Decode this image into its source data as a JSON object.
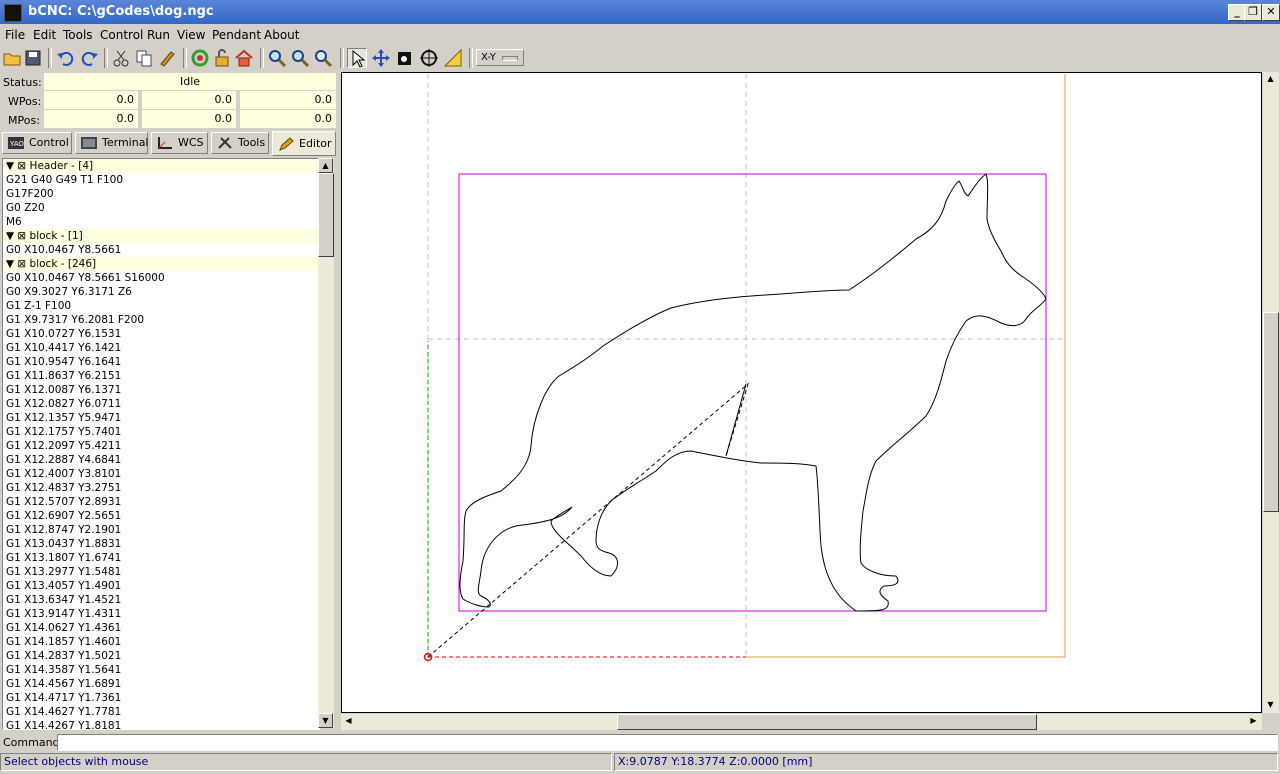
{
  "window": {
    "title": "bCNC: C:\\gCodes\\dog.ngc",
    "minimize": "_",
    "maximize": "❐",
    "close": "✕"
  },
  "menu": [
    "File",
    "Edit",
    "Tools",
    "Control",
    "Run",
    "View",
    "Pendant",
    "About"
  ],
  "toolbar": {
    "icons": [
      "open-icon",
      "save-icon",
      "undo-icon",
      "redo-icon",
      "cut-icon",
      "copy-icon",
      "paste-icon",
      "reload-icon",
      "unlock-icon",
      "home-icon",
      "zoom-in-icon",
      "zoom-out-icon",
      "zoom-fit-icon",
      "select-tool-icon",
      "pan-tool-icon",
      "camera-icon",
      "gantry-icon",
      "ruler-icon"
    ],
    "plane": "X-Y"
  },
  "status": {
    "label": "Status:",
    "value": "Idle",
    "wpos_label": "WPos:",
    "wpos": [
      "0.0",
      "0.0",
      "0.0"
    ],
    "mpos_label": "MPos:",
    "mpos": [
      "0.0",
      "0.0",
      "0.0"
    ]
  },
  "tabs": [
    "Control",
    "Terminal",
    "WCS",
    "Tools",
    "Editor"
  ],
  "selected_tab": "Editor",
  "editor_lines": [
    {
      "t": "▼ ⊠ Header - [4]",
      "block": true
    },
    {
      "t": "G21 G40 G49 T1 F100"
    },
    {
      "t": "G17F200"
    },
    {
      "t": "G0 Z20"
    },
    {
      "t": "M6"
    },
    {
      "t": "▼ ⊠ block - [1]",
      "block": true
    },
    {
      "t": "G0 X10.0467 Y8.5661"
    },
    {
      "t": "▼ ⊠ block - [246]",
      "block": true
    },
    {
      "t": "G0 X10.0467 Y8.5661 S16000"
    },
    {
      "t": "G0 X9.3027 Y6.3171 Z6"
    },
    {
      "t": "G1 Z-1 F100"
    },
    {
      "t": "G1 X9.7317 Y6.2081 F200"
    },
    {
      "t": "G1 X10.0727 Y6.1531"
    },
    {
      "t": "G1 X10.4417 Y6.1421"
    },
    {
      "t": "G1 X10.9547 Y6.1641"
    },
    {
      "t": "G1 X11.8637 Y6.2151"
    },
    {
      "t": "G1 X12.0087 Y6.1371"
    },
    {
      "t": "G1 X12.0827 Y6.0711"
    },
    {
      "t": "G1 X12.1357 Y5.9471"
    },
    {
      "t": "G1 X12.1757 Y5.7401"
    },
    {
      "t": "G1 X12.2097 Y5.4211"
    },
    {
      "t": "G1 X12.2887 Y4.6841"
    },
    {
      "t": "G1 X12.4007 Y3.8101"
    },
    {
      "t": "G1 X12.4837 Y3.2751"
    },
    {
      "t": "G1 X12.5707 Y2.8931"
    },
    {
      "t": "G1 X12.6907 Y2.5651"
    },
    {
      "t": "G1 X12.8747 Y2.1901"
    },
    {
      "t": "G1 X13.0437 Y1.8831"
    },
    {
      "t": "G1 X13.1807 Y1.6741"
    },
    {
      "t": "G1 X13.2977 Y1.5481"
    },
    {
      "t": "G1 X13.4057 Y1.4901"
    },
    {
      "t": "G1 X13.6347 Y1.4521"
    },
    {
      "t": "G1 X13.9147 Y1.4311"
    },
    {
      "t": "G1 X14.0627 Y1.4361"
    },
    {
      "t": "G1 X14.1857 Y1.4601"
    },
    {
      "t": "G1 X14.2837 Y1.5021"
    },
    {
      "t": "G1 X14.3587 Y1.5641"
    },
    {
      "t": "G1 X14.4567 Y1.6891"
    },
    {
      "t": "G1 X14.4717 Y1.7361"
    },
    {
      "t": "G1 X14.4627 Y1.7781"
    },
    {
      "t": "G1 X14.4267 Y1.8181"
    }
  ],
  "command": {
    "label": "Command:",
    "value": ""
  },
  "statusbar": {
    "left": "Select objects with mouse",
    "right": "X:9.0787  Y:18.3774  Z:0.0000 [mm]"
  },
  "colors": {
    "margin_box": "#cc00cc",
    "toolpath": "#000000",
    "x_axis": "#ff0000",
    "y_axis": "#00aa00",
    "work_area": "#e0a040",
    "grid": "#c0c0c0"
  }
}
